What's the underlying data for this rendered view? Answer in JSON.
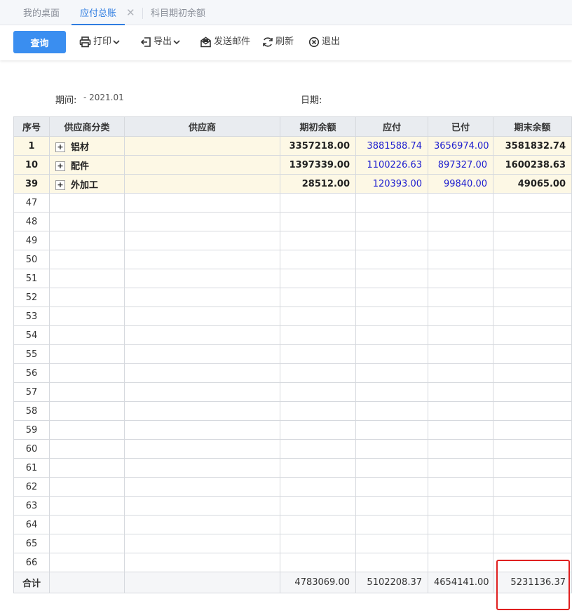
{
  "tabs": [
    {
      "label": "我的桌面"
    },
    {
      "label": "应付总账"
    },
    {
      "label": "科目期初余额"
    }
  ],
  "toolbar": {
    "query_label": "查询",
    "print_label": "打印",
    "export_label": "导出",
    "email_label": "发送邮件",
    "refresh_label": "刷新",
    "exit_label": "退出"
  },
  "info": {
    "period_label": "期间:",
    "period_value": "- 2021.01",
    "date_label": "日期:"
  },
  "columns": [
    "序号",
    "供应商分类",
    "供应商",
    "期初余额",
    "应付",
    "已付",
    "期末余额"
  ],
  "rows": [
    {
      "seq": "1",
      "category": "铝材",
      "supplier": "",
      "opening": "3357218.00",
      "payable": "3881588.74",
      "paid": "3656974.00",
      "closing": "3581832.74"
    },
    {
      "seq": "10",
      "category": "配件",
      "supplier": "",
      "opening": "1397339.00",
      "payable": "1100226.63",
      "paid": "897327.00",
      "closing": "1600238.63"
    },
    {
      "seq": "39",
      "category": "外加工",
      "supplier": "",
      "opening": "28512.00",
      "payable": "120393.00",
      "paid": "99840.00",
      "closing": "49065.00"
    }
  ],
  "empty_rows": [
    "47",
    "48",
    "49",
    "50",
    "51",
    "52",
    "53",
    "54",
    "55",
    "56",
    "57",
    "58",
    "59",
    "60",
    "61",
    "62",
    "63",
    "64",
    "65",
    "66"
  ],
  "total": {
    "label": "合计",
    "opening": "4783069.00",
    "payable": "5102208.37",
    "paid": "4654141.00",
    "closing": "5231136.37"
  },
  "expander_symbol": "+",
  "close_symbol": "✕",
  "colors": {
    "accent": "#3a8ef0",
    "link_value": "#2020d0",
    "row_highlight": "#fdf8e5",
    "annotation": "#e02020"
  }
}
